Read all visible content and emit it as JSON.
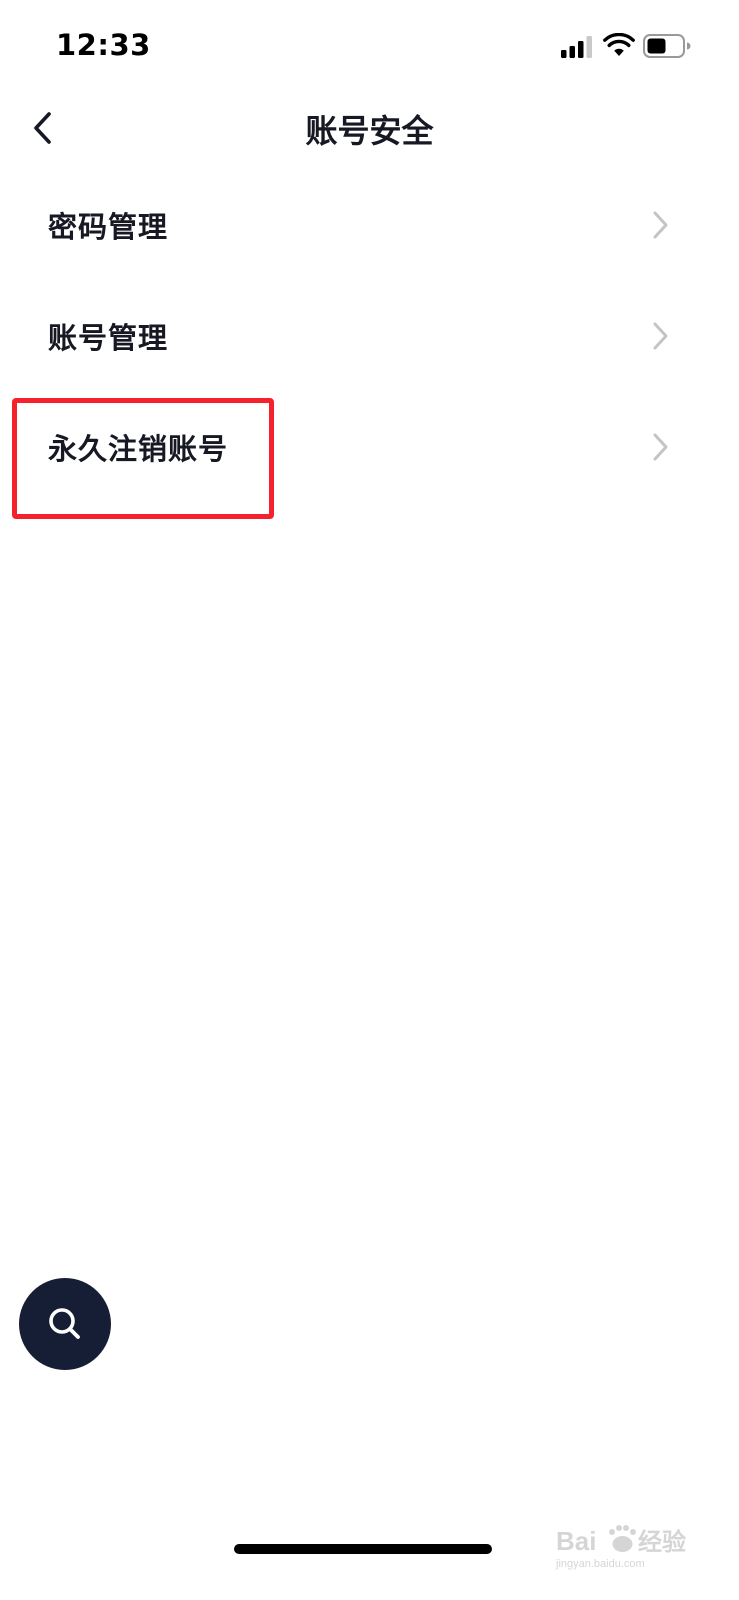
{
  "status_bar": {
    "time": "12:33",
    "icons": [
      "signal-icon",
      "wifi-icon",
      "battery-icon"
    ]
  },
  "header": {
    "back_icon": "chevron-left-icon",
    "title": "账号安全"
  },
  "menu": {
    "items": [
      {
        "label": "密码管理",
        "icon": "chevron-right-icon"
      },
      {
        "label": "账号管理",
        "icon": "chevron-right-icon"
      },
      {
        "label": "永久注销账号",
        "icon": "chevron-right-icon",
        "highlighted": true
      }
    ]
  },
  "highlight": {
    "color": "#f5222d"
  },
  "fab": {
    "icon": "search-icon",
    "color": "#161e35"
  },
  "watermark": {
    "mark": "Bai经验",
    "sub": "jingyan.baidu.com"
  },
  "colors": {
    "text_primary": "#161823",
    "chevron": "#c4c4c8",
    "background": "#ffffff"
  }
}
